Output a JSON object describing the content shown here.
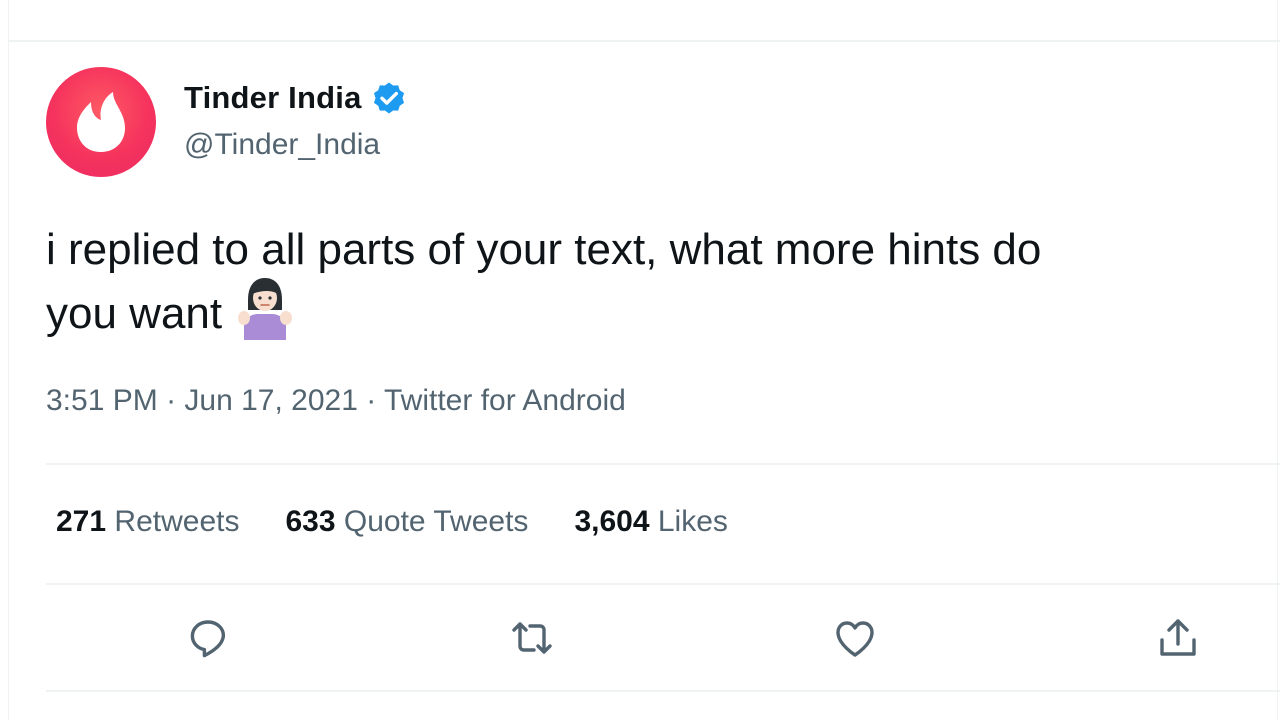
{
  "tweet": {
    "author": {
      "display_name": "Tinder India",
      "handle": "@Tinder_India",
      "avatar_icon": "tinder-flame-icon",
      "verified_icon": "verified-badge-icon"
    },
    "text_line1": "i replied to all parts of your text, what more hints do",
    "text_line2": "you want",
    "emoji_icon": "person-shrugging-emoji",
    "meta": {
      "time": "3:51 PM",
      "separator": " · ",
      "date": "Jun 17, 2021",
      "source": "Twitter for Android"
    },
    "stats": [
      {
        "num": "271",
        "label": "Retweets"
      },
      {
        "num": "633",
        "label": "Quote Tweets"
      },
      {
        "num": "3,604",
        "label": "Likes"
      }
    ],
    "actions": [
      "reply-icon",
      "retweet-icon",
      "like-icon",
      "share-icon"
    ]
  },
  "colors": {
    "text_primary": "#0f1419",
    "text_secondary": "#536471",
    "verified_blue": "#1d9bf0",
    "tinder_brand": "#f5335d"
  }
}
